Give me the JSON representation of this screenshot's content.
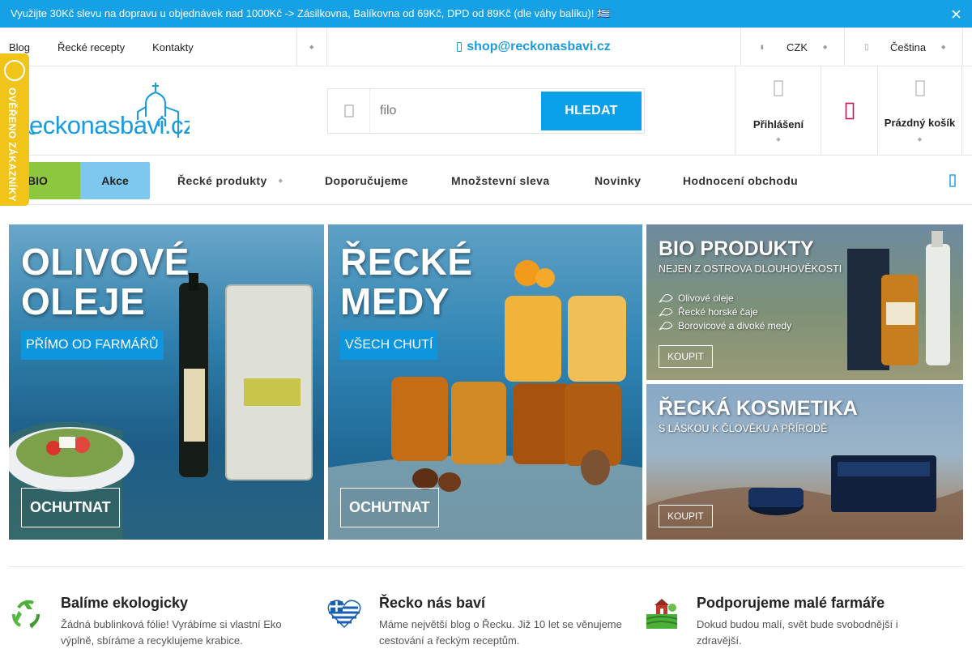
{
  "promo": {
    "text": "Využijte 30Kč slevu na dopravu u objednávek nad 1000Kč -> Zásilkovna, Balíkovna od 69Kč, DPD od 89Kč (dle váhy balíku)! 🇬🇷"
  },
  "topbar": {
    "links": [
      "Blog",
      "Řecké recepty",
      "Kontakty"
    ],
    "email": "shop@reckonasbavi.cz",
    "currency": "CZK",
    "language": "Čeština"
  },
  "logo": {
    "text": "reckonasbavi.cz"
  },
  "badge": {
    "text": "OVĚŘENO ZÁKAZNÍKY"
  },
  "search": {
    "placeholder": "filo",
    "button": "HLEDAT"
  },
  "header": {
    "login": "Přihlášení",
    "cart": "Prázdný košík"
  },
  "nav": {
    "bio": "BIO",
    "akce": "Akce",
    "items": [
      "Řecké produkty",
      "Doporučujeme",
      "Množstevní sleva",
      "Novinky",
      "Hodnocení obchodu"
    ]
  },
  "banners": {
    "olive": {
      "title_line1": "OLIVOVÉ",
      "title_line2": "OLEJE",
      "tag": "PŘÍMO OD FARMÁŘŮ",
      "cta": "OCHUTNAT"
    },
    "honey": {
      "title_line1": "ŘECKÉ",
      "title_line2": "MEDY",
      "tag": "VŠECH CHUTÍ",
      "cta": "OCHUTNAT"
    },
    "bio": {
      "title": "BIO PRODUKTY",
      "subtitle": "NEJEN Z OSTROVA DLOUHOVĚKOSTI",
      "items": [
        "Olivové oleje",
        "Řecké horské čaje",
        "Borovicové a divoké medy"
      ],
      "cta": "KOUPIT"
    },
    "cosmetics": {
      "title": "ŘECKÁ KOSMETIKA",
      "subtitle": "S LÁSKOU K ČLOVĚKU A PŘÍRODĚ",
      "cta": "KOUPIT"
    }
  },
  "features": [
    {
      "icon": "recycle-icon",
      "title": "Balíme ekologicky",
      "text": "Žádná bublinková fólie! Vyrábíme si vlastní Eko výplně, sbíráme a recyklujeme krabice."
    },
    {
      "icon": "greek-flag-heart-icon",
      "title": "Řecko nás baví",
      "text": "Máme největší blog o Řecku. Již 10 let se věnujeme cestování a řeckým receptům."
    },
    {
      "icon": "farm-icon",
      "title": "Podporujeme malé farmáře",
      "text": "Dokud budou malí, svět bude svobodnější i zdravější."
    }
  ],
  "colors": {
    "accent": "#16a1e7",
    "bio_green": "#8dc63f",
    "akce_blue": "#7ec8ef",
    "badge_yellow": "#f0c419"
  }
}
